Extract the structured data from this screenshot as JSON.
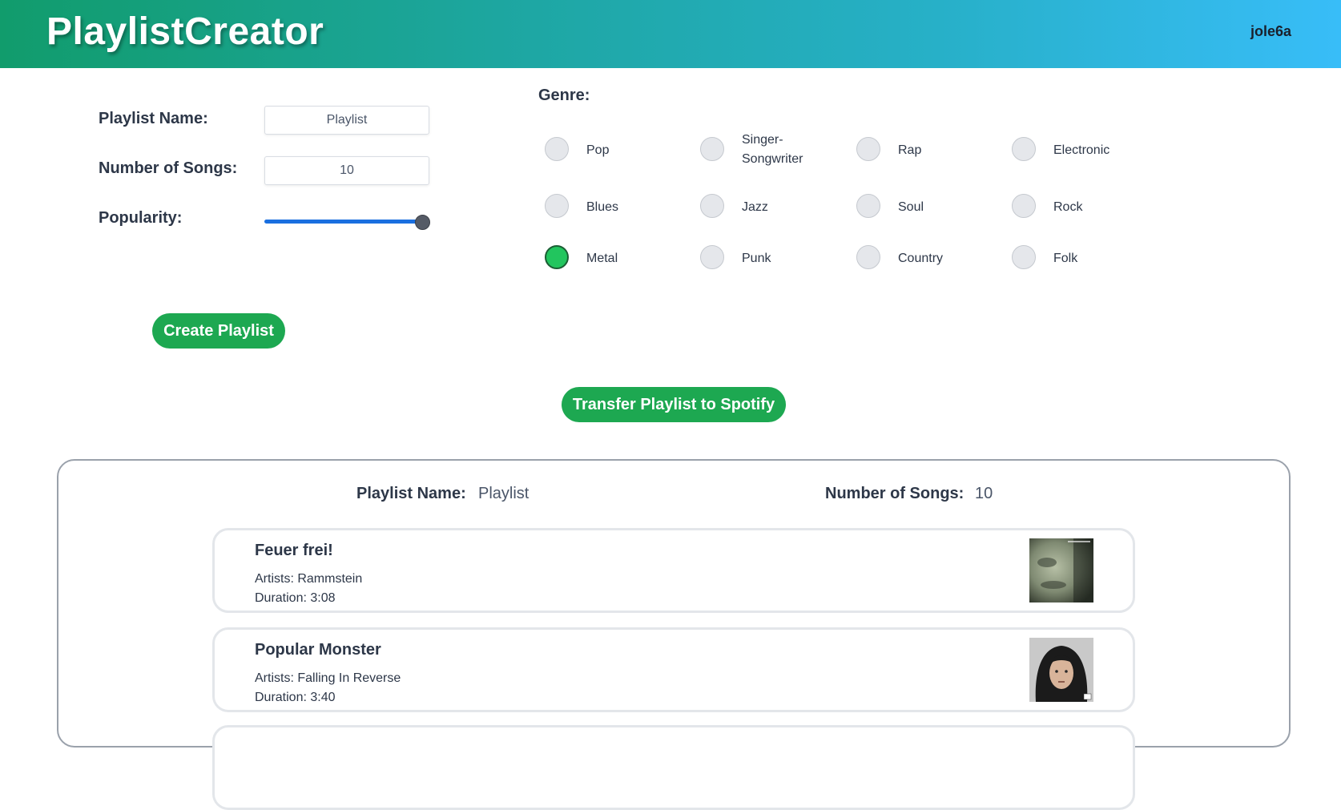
{
  "header": {
    "title": "PlaylistCreator",
    "username": "jole6a"
  },
  "form": {
    "playlist_name_label": "Playlist Name:",
    "playlist_name_value": "Playlist",
    "num_songs_label": "Number of Songs:",
    "num_songs_value": "10",
    "popularity_label": "Popularity:",
    "popularity_value": 1.0,
    "create_button": "Create Playlist"
  },
  "genres": {
    "title": "Genre:",
    "options": [
      {
        "label": "Pop",
        "selected": false
      },
      {
        "label": "Singer-Songwriter",
        "selected": false
      },
      {
        "label": "Rap",
        "selected": false
      },
      {
        "label": "Electronic",
        "selected": false
      },
      {
        "label": "Blues",
        "selected": false
      },
      {
        "label": "Jazz",
        "selected": false
      },
      {
        "label": "Soul",
        "selected": false
      },
      {
        "label": "Rock",
        "selected": false
      },
      {
        "label": "Metal",
        "selected": true
      },
      {
        "label": "Punk",
        "selected": false
      },
      {
        "label": "Country",
        "selected": false
      },
      {
        "label": "Folk",
        "selected": false
      }
    ]
  },
  "transfer_button": "Transfer Playlist to Spotify",
  "result": {
    "playlist_name_label": "Playlist Name:",
    "playlist_name_value": "Playlist",
    "num_songs_label": "Number of Songs:",
    "num_songs_value": "10",
    "songs": [
      {
        "title": "Feuer frei!",
        "artists": "Artists: Rammstein",
        "duration": "Duration: 3:08"
      },
      {
        "title": "Popular Monster",
        "artists": "Artists: Falling In Reverse",
        "duration": "Duration: 3:40"
      }
    ]
  },
  "colors": {
    "accent_green": "#1da851",
    "selected_radio": "#22c55e",
    "slider": "#1a6fe0"
  }
}
